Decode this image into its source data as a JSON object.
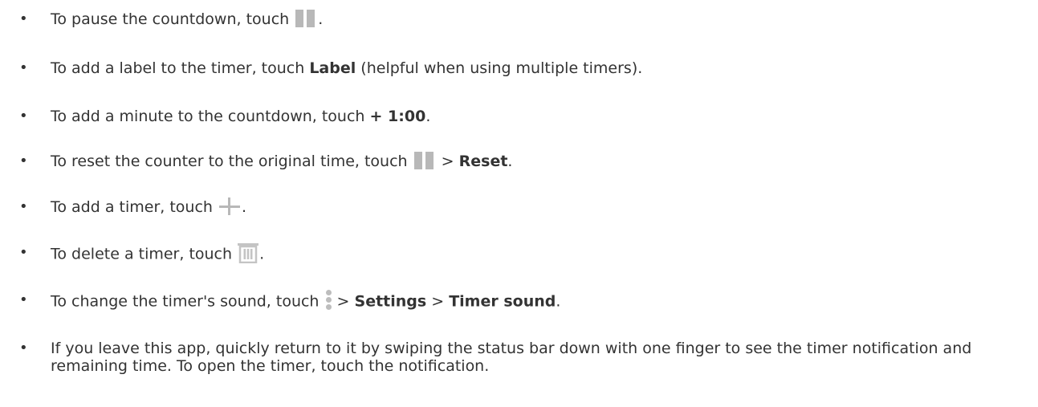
{
  "bullet": "•",
  "items": [
    {
      "pre": "To pause the countdown, touch ",
      "icon": "pause-icon",
      "post": "."
    },
    {
      "pre": "To add a label to the timer, touch ",
      "bold1": "Label",
      "post": " (helpful when using multiple timers)."
    },
    {
      "pre": "To add a minute to the countdown, touch ",
      "bold1": "+ 1:00",
      "post": "."
    },
    {
      "pre": "To reset the counter to the original time, touch ",
      "icon": "pause-icon",
      "mid": " > ",
      "bold1": "Reset",
      "post": "."
    },
    {
      "pre": "To add a timer, touch ",
      "icon": "plus-icon",
      "post": "."
    },
    {
      "pre": "To delete a timer, touch ",
      "icon": "trash-icon",
      "post": "."
    },
    {
      "pre": "To change the timer's sound, touch ",
      "icon": "more-vert-icon",
      "mid": " > ",
      "bold1": "Settings",
      "mid2": " > ",
      "bold2": "Timer sound",
      "post": "."
    },
    {
      "text": "If you leave this app, quickly return to it by swiping the status bar down with one finger to see the timer notification and remaining time. To open the timer, touch the notification."
    }
  ]
}
